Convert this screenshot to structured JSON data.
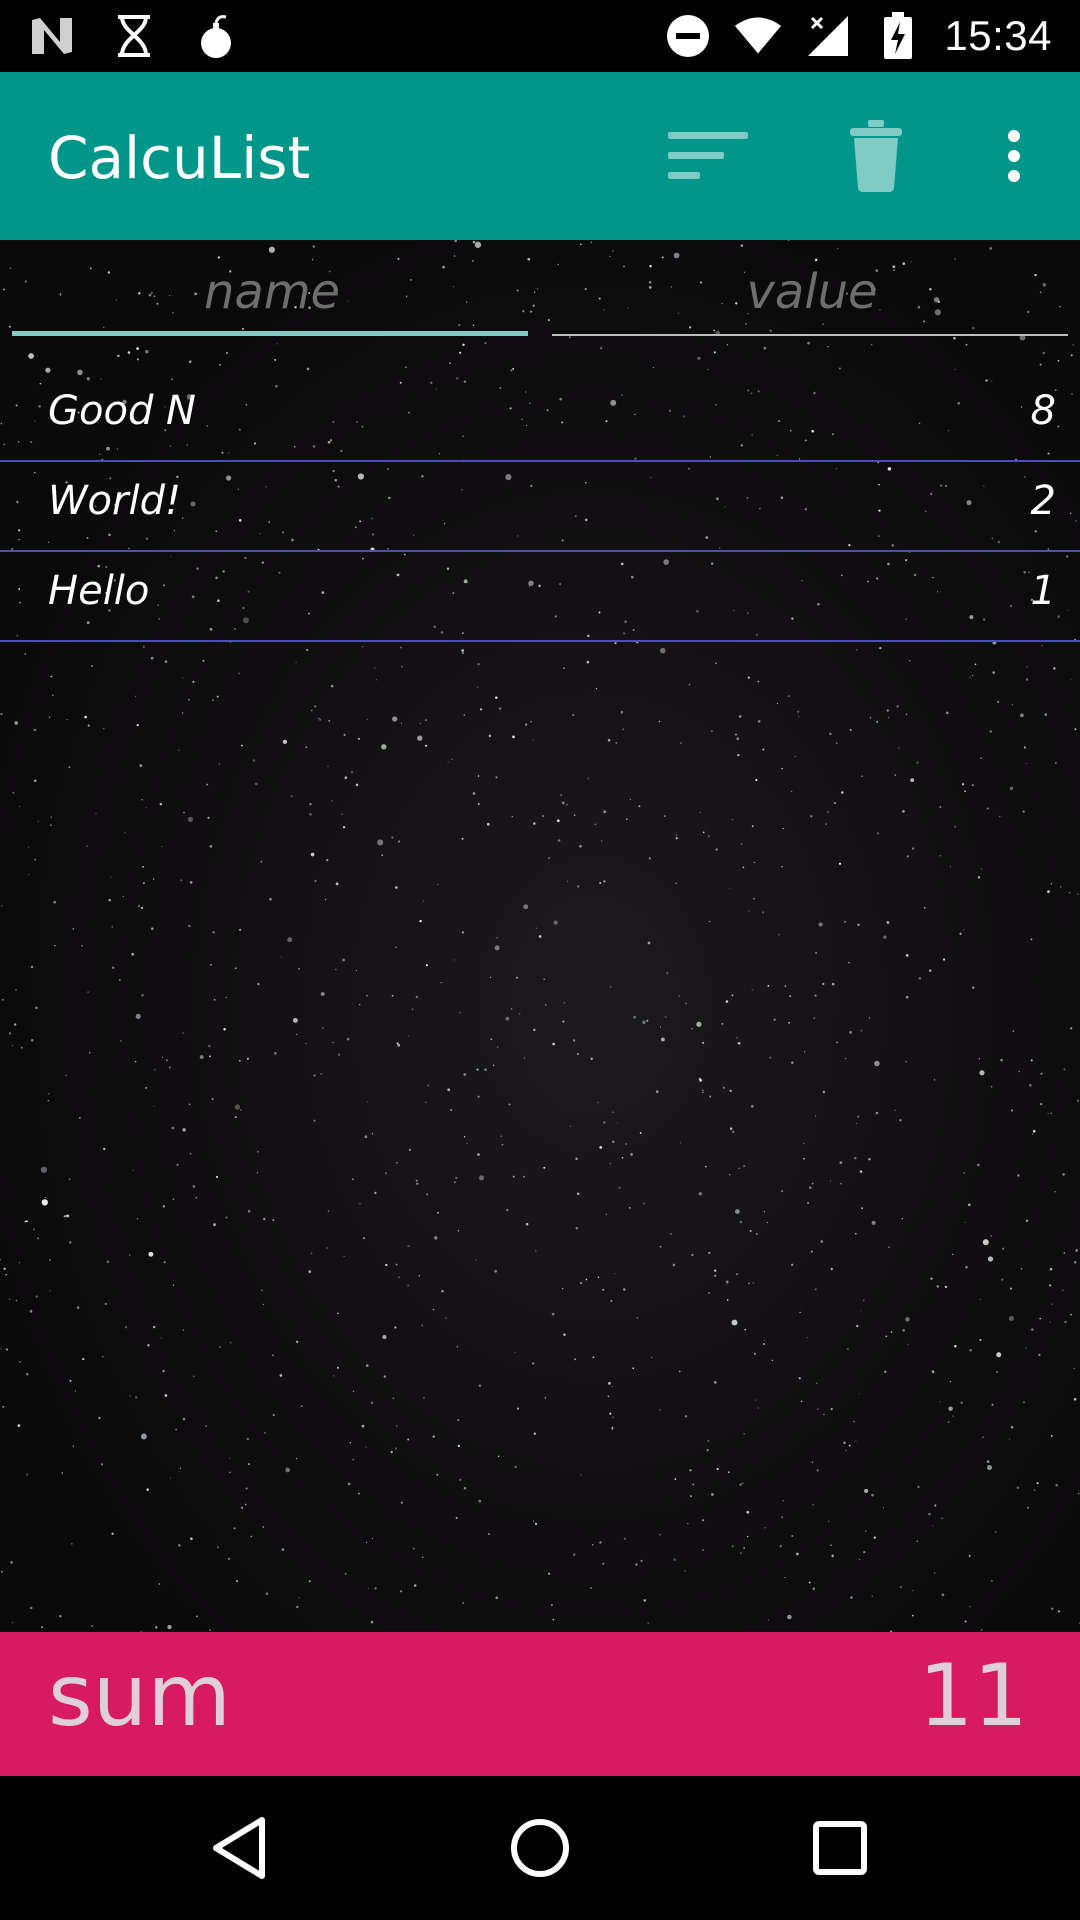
{
  "status_bar": {
    "time": "15:34",
    "left_icons": [
      "n-logo-icon",
      "hourglass-icon",
      "bomb-icon"
    ],
    "right_icons": [
      "do-not-disturb-icon",
      "wifi-icon",
      "signal-icon",
      "battery-charging-icon"
    ]
  },
  "app_bar": {
    "title": "CalcuList",
    "actions": [
      "sort-icon",
      "trash-icon",
      "overflow-menu-icon"
    ]
  },
  "inputs": {
    "name_placeholder": "name",
    "value_placeholder": "value",
    "name_value": "",
    "value_value": ""
  },
  "items": [
    {
      "name": "Good N",
      "value": "8"
    },
    {
      "name": "World!",
      "value": "2"
    },
    {
      "name": "Hello",
      "value": "1"
    }
  ],
  "sum": {
    "label": "sum",
    "value": "11"
  },
  "nav": [
    "back-icon",
    "home-icon",
    "recents-icon"
  ],
  "colors": {
    "app_bar": "#00968A",
    "sum_bar": "#D81B60",
    "accent": "#80CBC4",
    "divider": "#4A50B4"
  }
}
